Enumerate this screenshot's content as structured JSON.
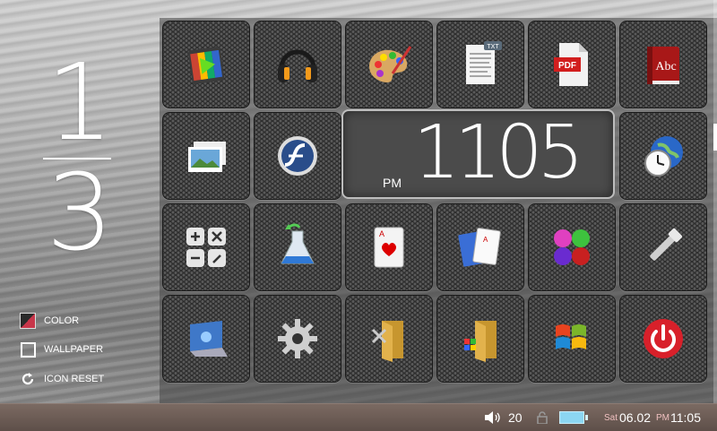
{
  "page_indicator": {
    "current": "1",
    "total": "3"
  },
  "options": {
    "color": "COLOR",
    "wallpaper": "WALLPAPER",
    "icon_reset": "ICON RESET"
  },
  "clock": {
    "ampm": "PM",
    "time": "1105"
  },
  "status": {
    "volume": "20",
    "day": "Sat",
    "date": "06.02",
    "ampm": "PM",
    "time": "11:05"
  },
  "icons": [
    "media-player-icon",
    "headphones-icon",
    "paint-palette-icon",
    "txt-document-icon",
    "pdf-document-icon",
    "dictionary-icon",
    "photo-gallery-icon",
    "flash-player-icon",
    "world-clock-icon",
    "calculator-icon",
    "science-flask-icon",
    "card-game-icon",
    "solitaire-icon",
    "color-balls-icon",
    "flashlight-icon",
    "display-settings-icon",
    "settings-gear-icon",
    "tools-folder-icon",
    "windows-folder-icon",
    "windows-logo-icon",
    "power-icon"
  ],
  "colors": {
    "statusbar": "#6b5b54",
    "accent_red": "#d8202a",
    "battery": "#8cd6f2"
  }
}
